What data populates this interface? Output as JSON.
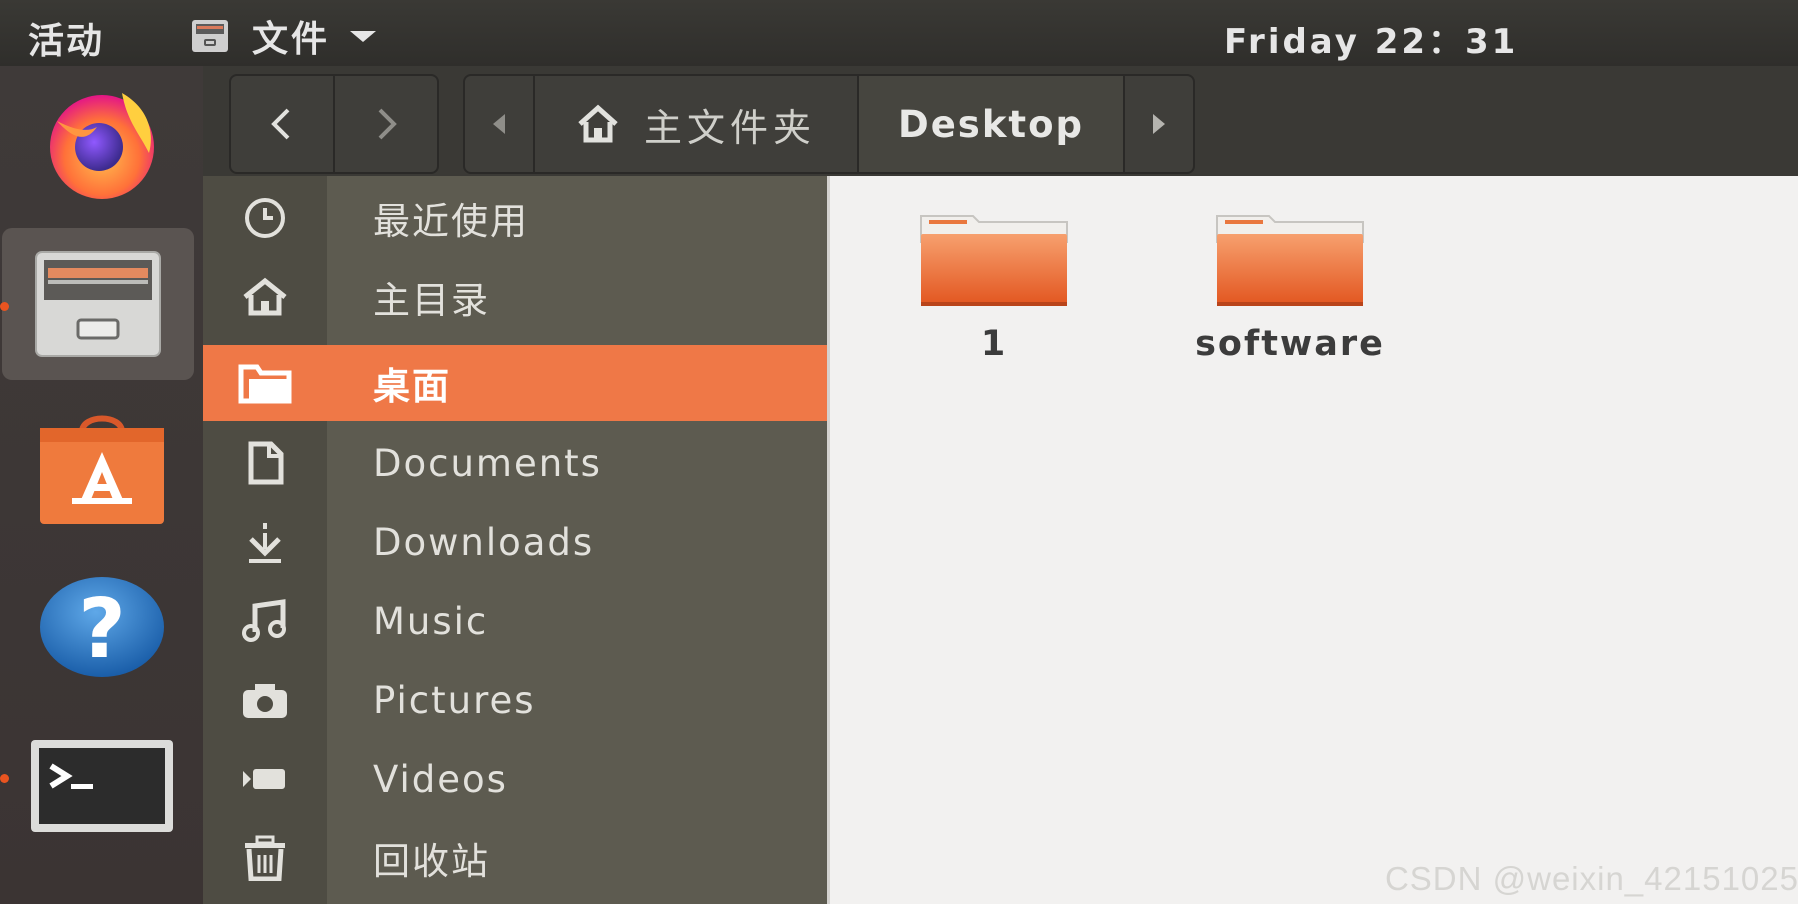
{
  "topbar": {
    "activities": "活动",
    "app_menu_label": "文件",
    "app_menu_icon": "file-cabinet-icon",
    "clock": "Friday 22：31"
  },
  "dock": {
    "items": [
      {
        "name": "firefox",
        "icon": "firefox-icon",
        "running": false,
        "active": false
      },
      {
        "name": "files",
        "icon": "file-cabinet-icon",
        "running": true,
        "active": true
      },
      {
        "name": "software",
        "icon": "software-bag-icon",
        "running": false,
        "active": false
      },
      {
        "name": "help",
        "icon": "help-icon",
        "running": false,
        "active": false
      },
      {
        "name": "terminal",
        "icon": "terminal-icon",
        "running": true,
        "active": false
      }
    ]
  },
  "toolbar": {
    "path": [
      {
        "label": "主文件夹",
        "icon": "home-icon"
      },
      {
        "label": "Desktop",
        "current": true
      }
    ]
  },
  "sidebar": {
    "items": [
      {
        "label": "最近使用",
        "icon": "clock-icon"
      },
      {
        "label": "主目录",
        "icon": "home-icon"
      },
      {
        "label": "桌面",
        "icon": "folder-icon",
        "selected": true
      },
      {
        "label": "Documents",
        "icon": "document-icon"
      },
      {
        "label": "Downloads",
        "icon": "download-icon"
      },
      {
        "label": "Music",
        "icon": "music-icon"
      },
      {
        "label": "Pictures",
        "icon": "camera-icon"
      },
      {
        "label": "Videos",
        "icon": "video-icon"
      },
      {
        "label": "回收站",
        "icon": "trash-icon"
      }
    ]
  },
  "files": [
    {
      "name": "1",
      "type": "folder"
    },
    {
      "name": "software",
      "type": "folder"
    }
  ],
  "watermark": "CSDN @weixin_42151025",
  "colors": {
    "accent": "#E95420",
    "selection": "#EF7847",
    "sidebar": "#5D5B50",
    "content_bg": "#F2F1F0"
  }
}
